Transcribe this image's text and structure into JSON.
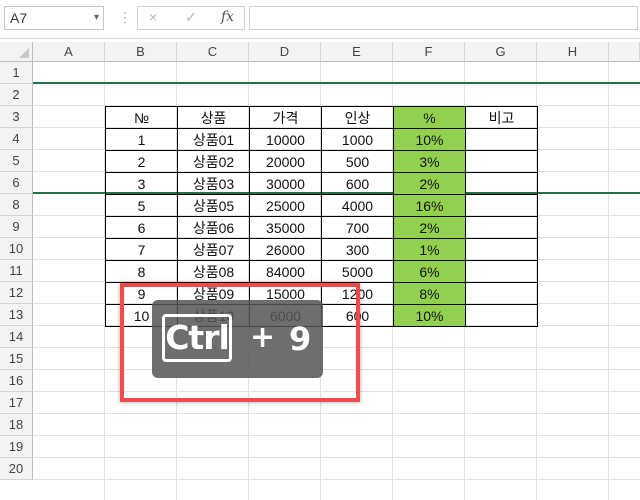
{
  "formula_bar": {
    "name_box": "A7",
    "name_box_dropdown": "▾",
    "separator": "⋮",
    "cancel_icon": "×",
    "enter_icon": "✓",
    "fx_label": "fx",
    "formula_value": ""
  },
  "columns": [
    "A",
    "B",
    "C",
    "D",
    "E",
    "F",
    "G",
    "H"
  ],
  "rows": [
    "1",
    "2",
    "3",
    "4",
    "5",
    "6",
    "8",
    "9",
    "10",
    "11",
    "12",
    "13",
    "14",
    "15",
    "16",
    "17",
    "18",
    "19",
    "20"
  ],
  "table": {
    "headers": [
      "№",
      "상품",
      "가격",
      "인상",
      "%",
      "비고"
    ],
    "rows": [
      [
        "1",
        "상품01",
        "10000",
        "1000",
        "10%",
        ""
      ],
      [
        "2",
        "상품02",
        "20000",
        "500",
        "3%",
        ""
      ],
      [
        "3",
        "상품03",
        "30000",
        "600",
        "2%",
        ""
      ],
      [
        "5",
        "상품05",
        "25000",
        "4000",
        "16%",
        ""
      ],
      [
        "6",
        "상품06",
        "35000",
        "700",
        "2%",
        ""
      ],
      [
        "7",
        "상품07",
        "26000",
        "300",
        "1%",
        ""
      ],
      [
        "8",
        "상품08",
        "84000",
        "5000",
        "6%",
        ""
      ],
      [
        "9",
        "상품09",
        "15000",
        "1200",
        "8%",
        ""
      ],
      [
        "10",
        "상품10",
        "6000",
        "600",
        "10%",
        ""
      ]
    ]
  },
  "shortcut_overlay": {
    "key1": "Ctrl",
    "plus": "+",
    "key2": "9"
  },
  "colors": {
    "percent_fill": "#92d050",
    "hidden_row_marker": "#217346",
    "highlight_border": "#f04a4a"
  }
}
